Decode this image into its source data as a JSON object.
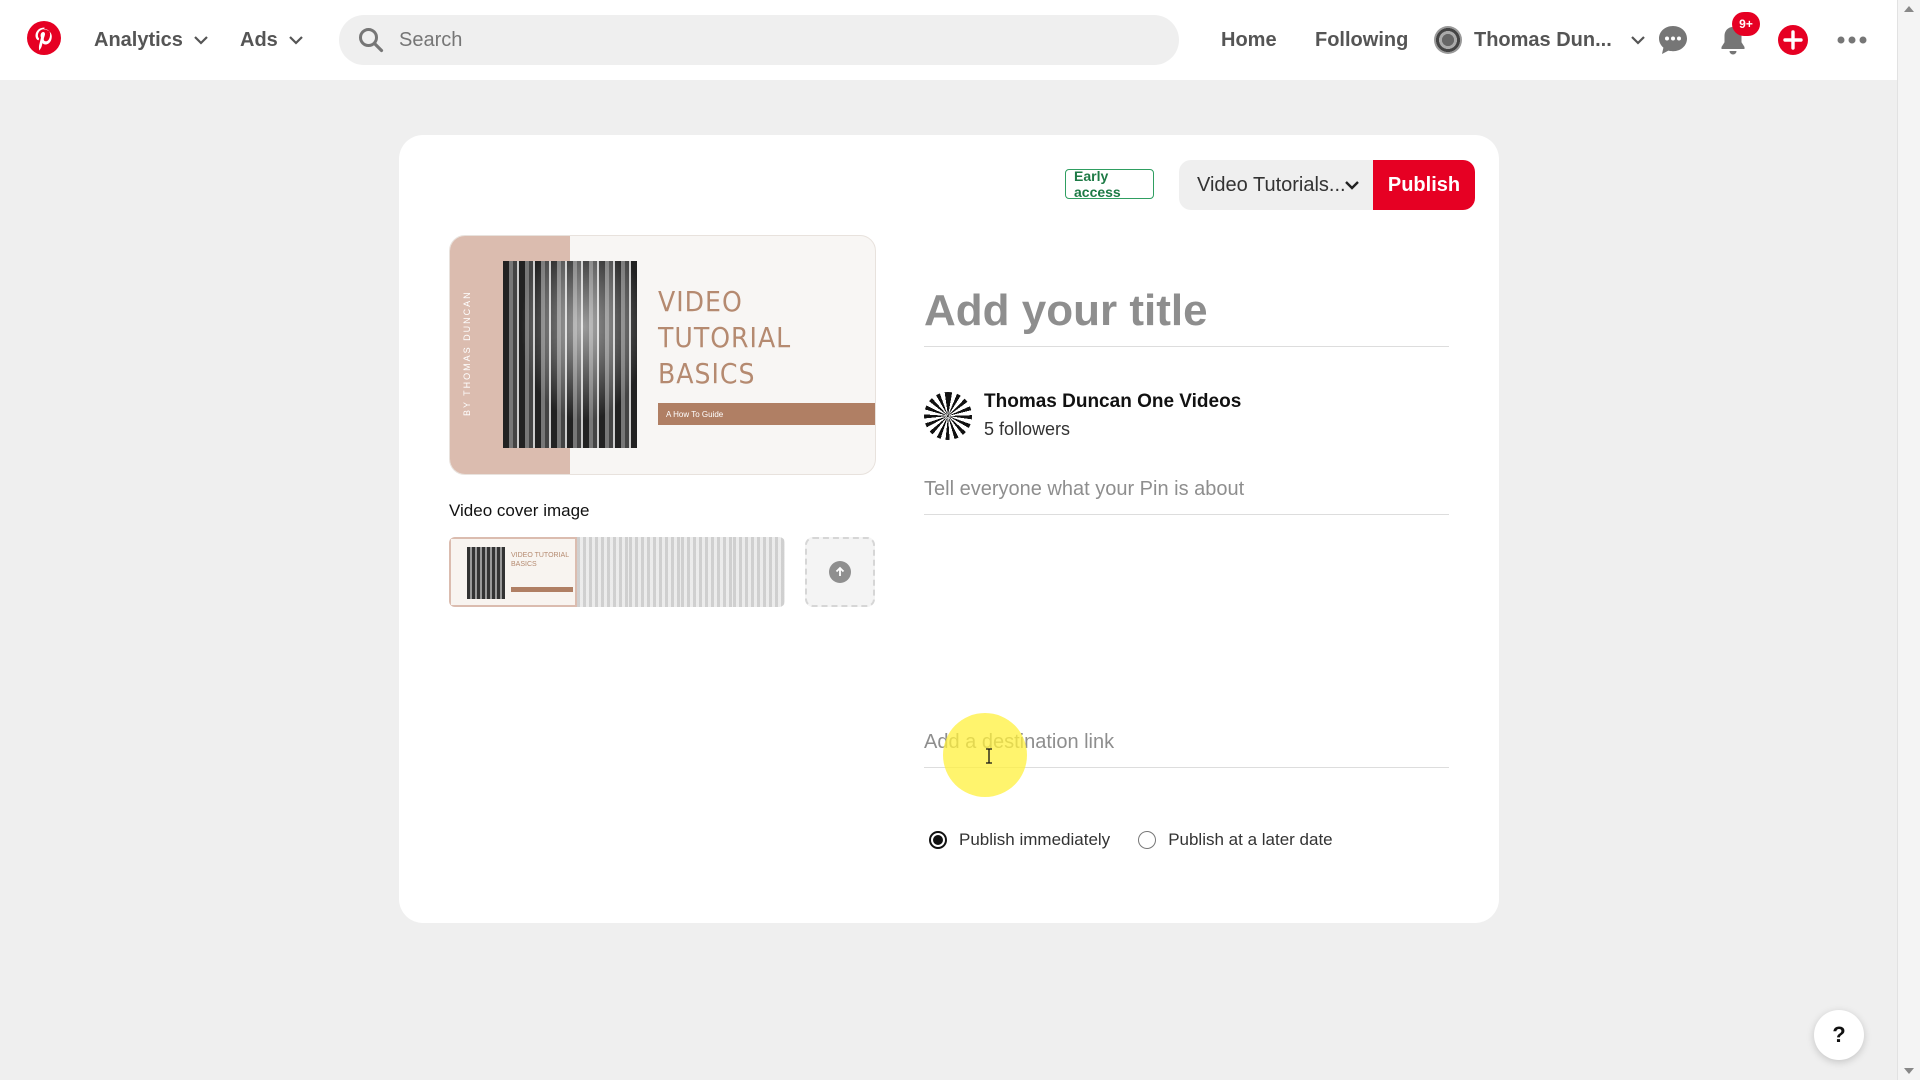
{
  "nav": {
    "analytics_label": "Analytics",
    "ads_label": "Ads",
    "search_placeholder": "Search",
    "home_label": "Home",
    "following_label": "Following",
    "profile_name": "Thomas Dun...",
    "notification_badge": "9+"
  },
  "editor": {
    "early_access_label": "Early access",
    "board_select_value": "Video Tutorials...",
    "publish_label": "Publish",
    "cover": {
      "side_text": "BY THOMAS DUNCAN",
      "heading": "VIDEO TUTORIAL BASICS",
      "subtitle": "A How To Guide"
    },
    "cover_image_label": "Video cover image",
    "thumb_heading": "VIDEO TUTORIAL BASICS",
    "title_placeholder": "Add your title",
    "owner_name": "Thomas Duncan One Videos",
    "owner_followers": "5 followers",
    "description_placeholder": "Tell everyone what your Pin is about",
    "link_placeholder": "Add a destination link",
    "publish_options": {
      "immediately_label": "Publish immediately",
      "later_label": "Publish at a later date",
      "selected": "immediately"
    }
  },
  "help_label": "?",
  "colors": {
    "brand_red": "#e60023",
    "early_access_green": "#1d7a45",
    "cover_accent": "#b58a70"
  }
}
